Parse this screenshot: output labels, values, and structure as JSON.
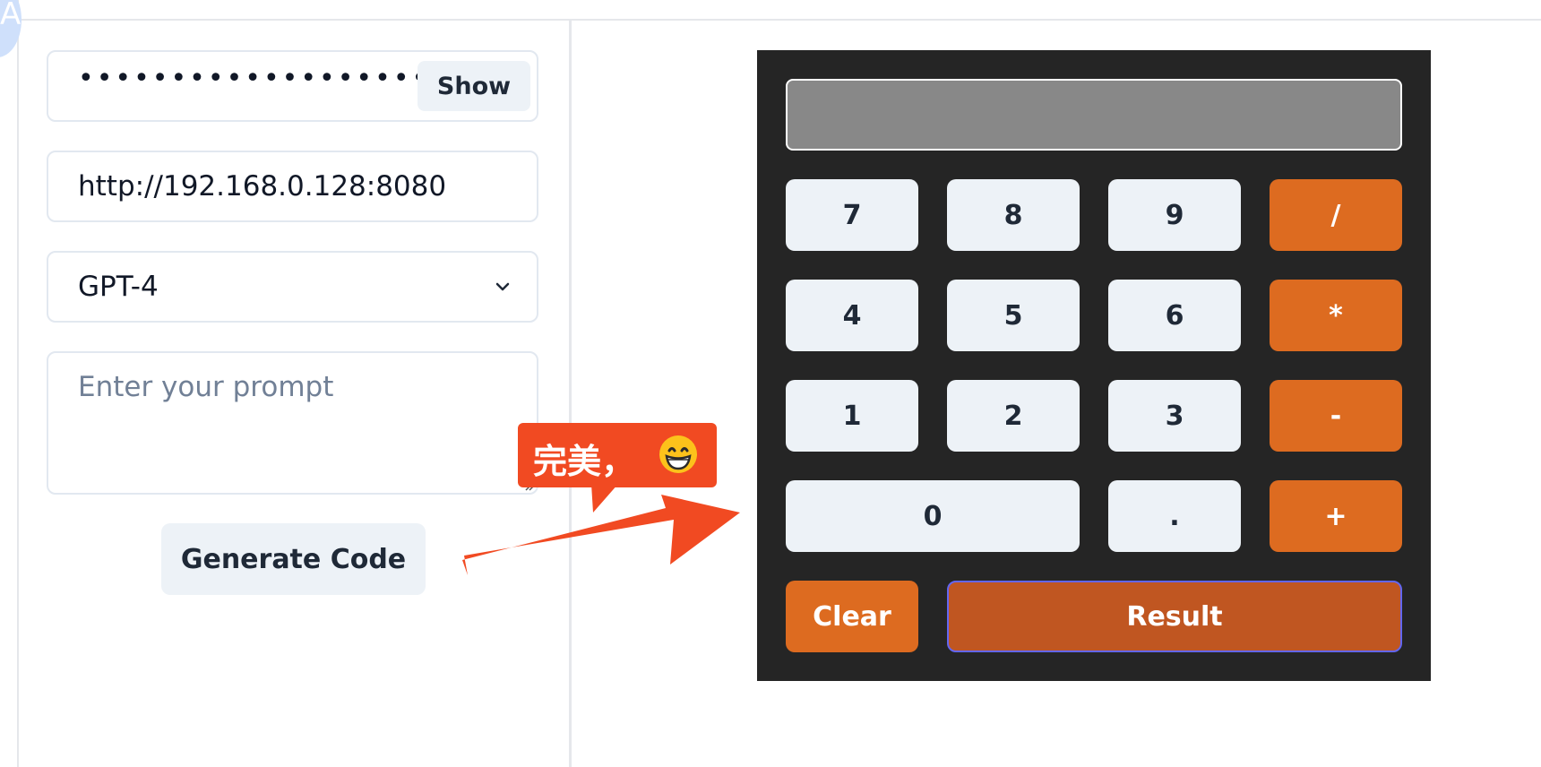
{
  "sidebar_avatar": {
    "letter": "A"
  },
  "form": {
    "api_key_masked": "•••••••••••••••••••••••••",
    "show_label": "Show",
    "url_value": "http://192.168.0.128:8080",
    "model_selected": "GPT-4",
    "prompt_placeholder": "Enter your prompt",
    "generate_label": "Generate Code"
  },
  "calculator": {
    "display_value": "",
    "keys": {
      "k7": "7",
      "k8": "8",
      "k9": "9",
      "div": "/",
      "k4": "4",
      "k5": "5",
      "k6": "6",
      "mul": "*",
      "k1": "1",
      "k2": "2",
      "k3": "3",
      "sub": "-",
      "k0": "0",
      "dot": ".",
      "add": "+",
      "clear": "Clear",
      "result": "Result"
    },
    "colors": {
      "background": "#252525",
      "operator": "#dd6b20",
      "result": "#c05621",
      "digit": "#edf2f7"
    }
  },
  "annotation": {
    "callout_text": "完美，",
    "emoji": "grinning-face-emoji",
    "color": "#f14a22"
  }
}
